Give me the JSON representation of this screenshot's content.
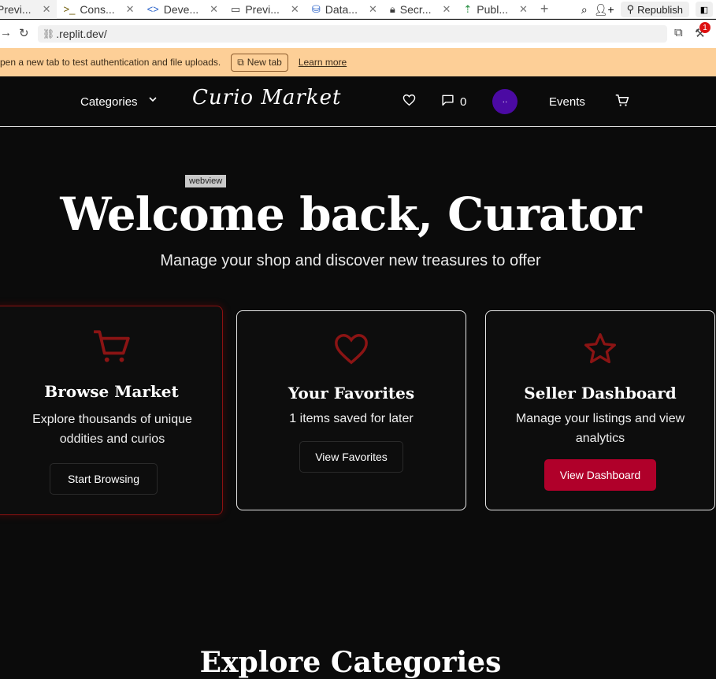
{
  "browser": {
    "tabs": [
      {
        "label": "Previ...",
        "icon": "preview-icon"
      },
      {
        "label": "Cons...",
        "icon": "console-icon"
      },
      {
        "label": "Deve...",
        "icon": "devtools-icon"
      },
      {
        "label": "Previ...",
        "icon": "monitor-icon"
      },
      {
        "label": "Data...",
        "icon": "database-icon"
      },
      {
        "label": "Secr...",
        "icon": "lock-icon"
      },
      {
        "label": "Publ...",
        "icon": "publish-icon"
      }
    ],
    "republish_label": "Republish",
    "notification_count": "1",
    "url": ".replit.dev/"
  },
  "banner": {
    "message": "pen a new tab to test authentication and file uploads.",
    "new_tab_label": "New tab",
    "learn_more_label": "Learn more"
  },
  "nav": {
    "categories_label": "Categories",
    "logo_first": "Curio",
    "logo_second": "Market",
    "message_count": "0",
    "avatar_initials": "··",
    "events_label": "Events"
  },
  "hero": {
    "badge": "webview",
    "title": "Welcome back, Curator",
    "subtitle": "Manage your shop and discover new treasures to offer"
  },
  "cards": [
    {
      "title": "Browse Market",
      "text": "Explore thousands of unique oddities and curios",
      "button": "Start Browsing",
      "icon": "cart-icon"
    },
    {
      "title": "Your Favorites",
      "text": "1 items saved for later",
      "button": "View Favorites",
      "icon": "heart-icon"
    },
    {
      "title": "Seller Dashboard",
      "text": "Manage your listings and view analytics",
      "button": "View Dashboard",
      "icon": "star-icon"
    }
  ],
  "section_title": "Explore Categories",
  "colors": {
    "accent_red": "#b0002a",
    "icon_red": "#8b1414",
    "banner": "#fdcf97",
    "avatar": "#4b0aa3",
    "background": "#0b0b0b"
  }
}
